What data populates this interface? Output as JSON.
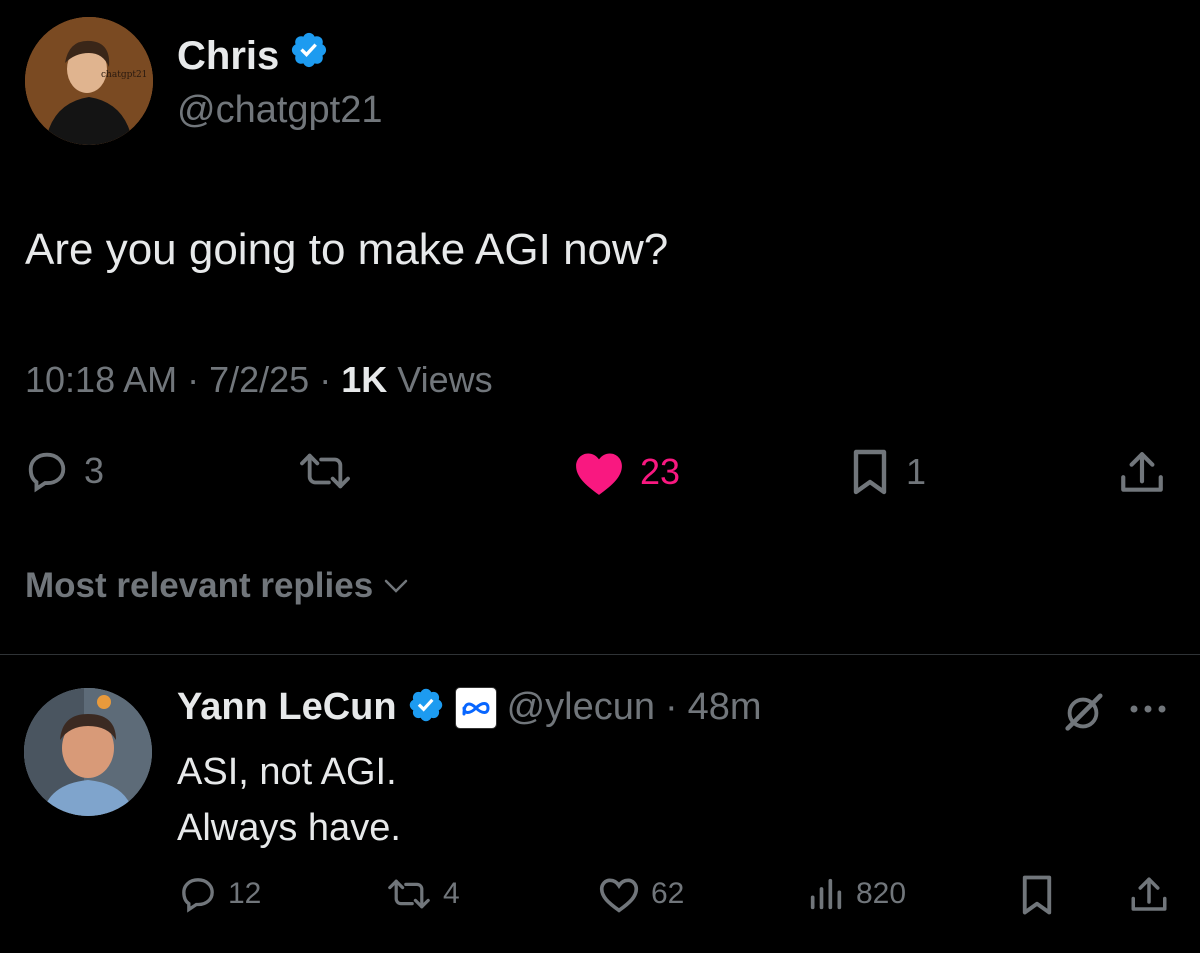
{
  "tweet": {
    "author_name": "Chris",
    "author_handle": "@chatgpt21",
    "avatar_watermark": "chatgpt21",
    "text": "Are you going to make AGI now?",
    "time": "10:18 AM",
    "date": "7/2/25",
    "views_count": "1K",
    "views_label": "Views",
    "reply_count": "3",
    "like_count": "23",
    "bookmark_count": "1"
  },
  "replies_sort_label": "Most relevant replies",
  "reply": {
    "author_name": "Yann LeCun",
    "author_handle": "@ylecun",
    "age": "48m",
    "text_line1": "ASI, not AGI.",
    "text_line2": "Always have.",
    "reply_count": "12",
    "retweet_count": "4",
    "like_count": "62",
    "views_count": "820"
  },
  "colors": {
    "background": "#000000",
    "text_primary": "#e7e9ea",
    "text_secondary": "#71767b",
    "verified_blue": "#1d9bf0",
    "like_pink": "#f91880",
    "divider": "#2f3336"
  },
  "icons": [
    "verified-badge-icon",
    "reply-icon",
    "retweet-icon",
    "heart-filled-icon",
    "heart-outline-icon",
    "bookmark-icon",
    "share-icon",
    "chevron-down-icon",
    "meta-affiliate-icon",
    "grok-icon",
    "more-icon",
    "views-icon"
  ]
}
